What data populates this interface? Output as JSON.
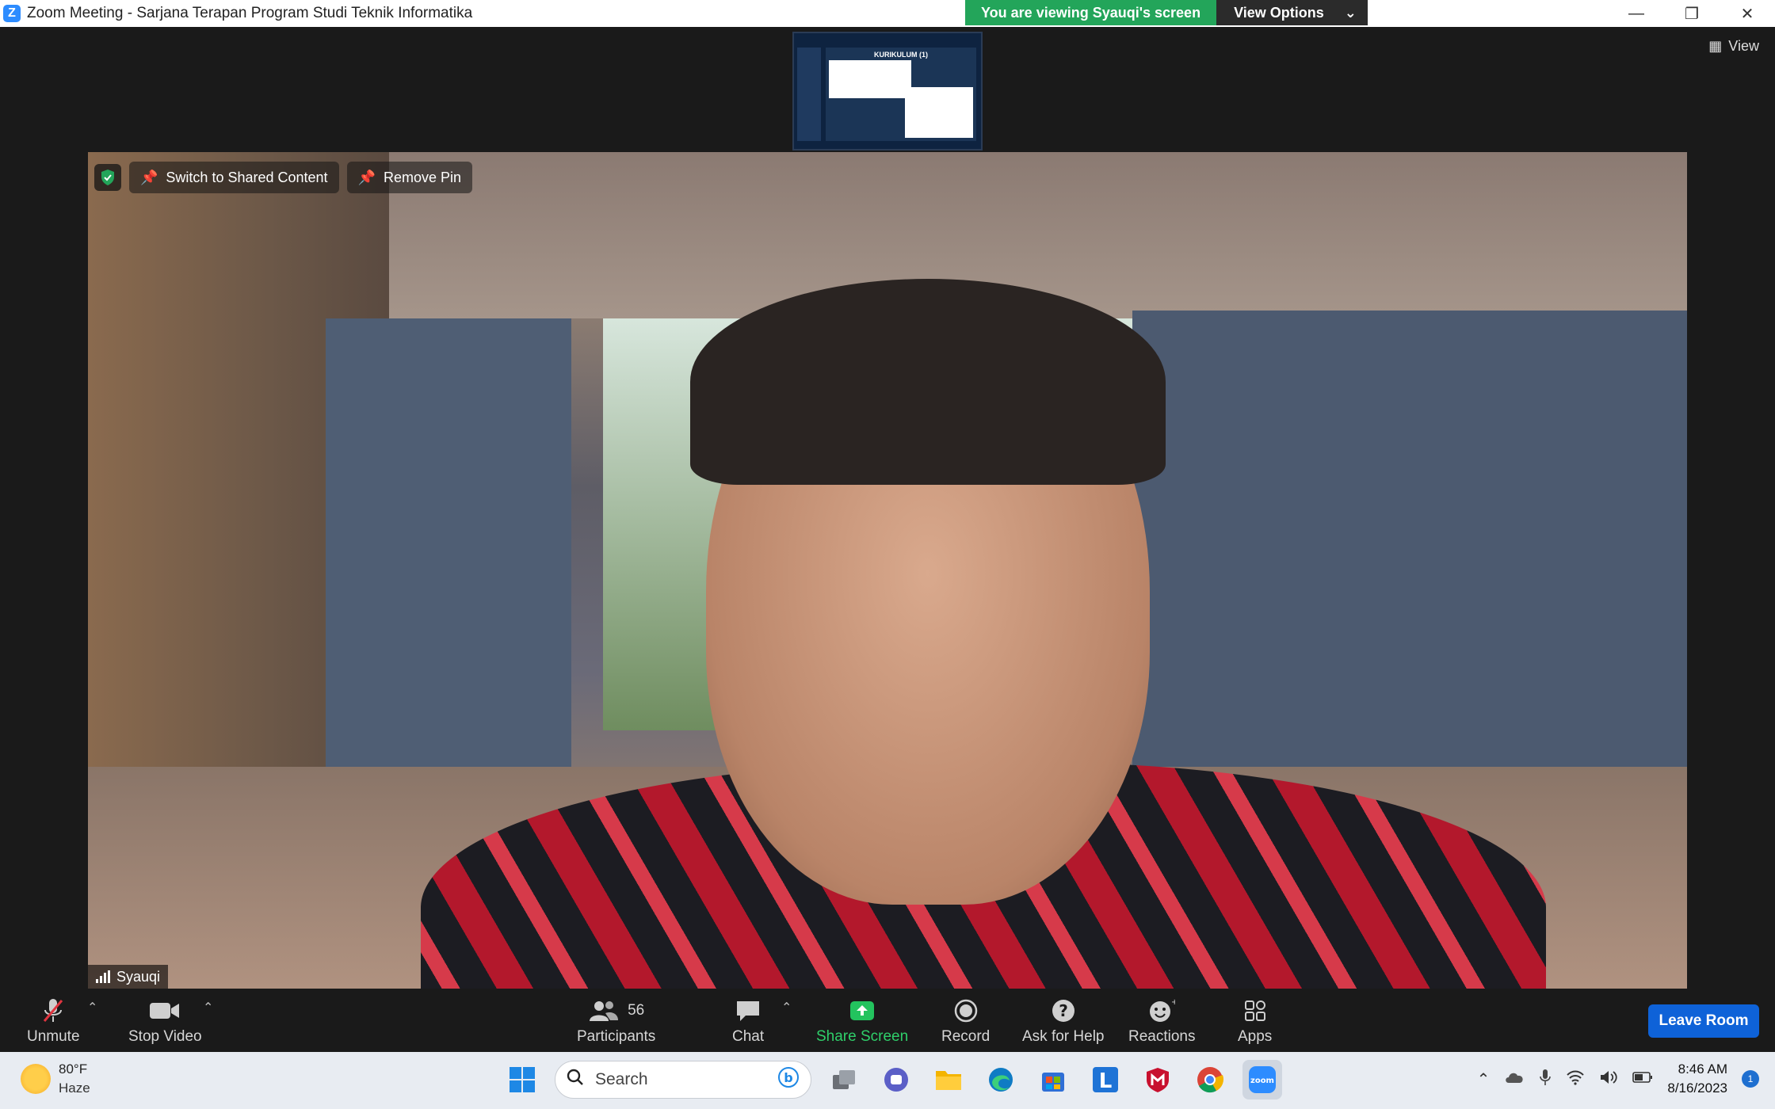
{
  "window": {
    "title": "Zoom Meeting - Sarjana Terapan Program Studi Teknik Informatika",
    "logo_letter": "Z"
  },
  "banner": {
    "viewing_text": "You are viewing Syauqi's screen",
    "view_options_label": "View Options"
  },
  "stage": {
    "view_label": "View",
    "thumbnail_slide_title": "KURIKULUM (1)"
  },
  "video": {
    "switch_label": "Switch to Shared Content",
    "remove_pin_label": "Remove Pin",
    "participant_name": "Syauqi"
  },
  "toolbar": {
    "unmute": "Unmute",
    "stop_video": "Stop Video",
    "participants_label": "Participants",
    "participants_count": "56",
    "chat": "Chat",
    "share_screen": "Share Screen",
    "record": "Record",
    "ask_for_help": "Ask for Help",
    "reactions": "Reactions",
    "apps": "Apps",
    "leave_room": "Leave Room"
  },
  "taskbar": {
    "weather_temp": "80°F",
    "weather_condition": "Haze",
    "search_placeholder": "Search",
    "time": "8:46 AM",
    "date": "8/16/2023",
    "notification_count": "1"
  },
  "colors": {
    "banner_green": "#23a55a",
    "share_green": "#2fcf6a",
    "leave_blue": "#0e62d8",
    "zoom_blue": "#2d8cff"
  }
}
